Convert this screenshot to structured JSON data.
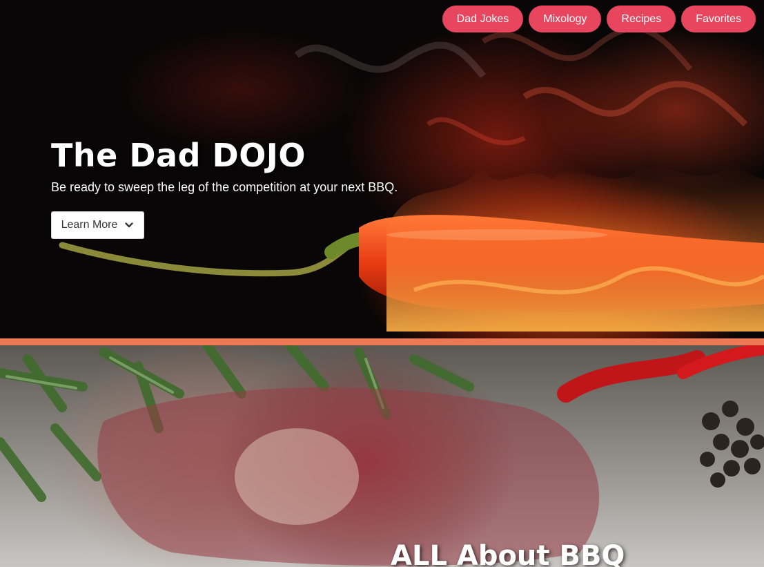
{
  "nav": {
    "items": [
      {
        "label": "Dad Jokes"
      },
      {
        "label": "Mixology"
      },
      {
        "label": "Recipes"
      },
      {
        "label": "Favorites"
      }
    ],
    "color": "#e8455e"
  },
  "hero": {
    "title": "The Dad DOJO",
    "subtitle": "Be ready to sweep the leg of the competition at your next BBQ.",
    "button_label": "Learn More",
    "button_icon": "chevron-down-icon"
  },
  "divider_color": "#ee7a55",
  "section2": {
    "title": "ALL About BBQ"
  }
}
